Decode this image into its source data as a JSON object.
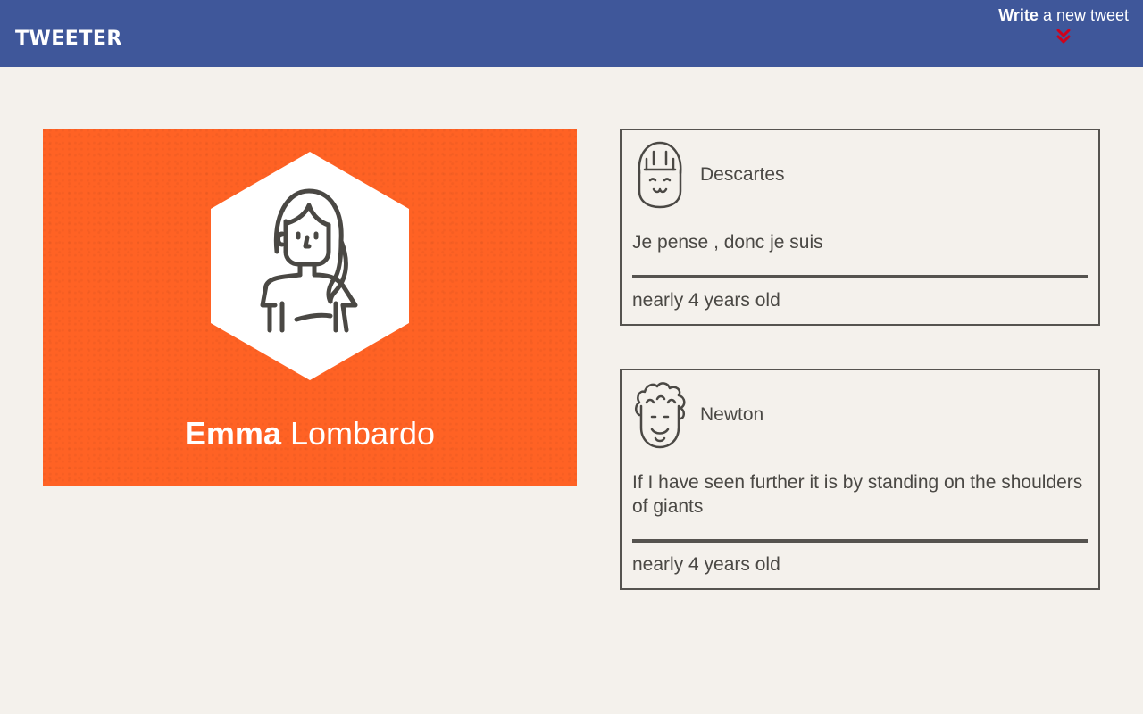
{
  "header": {
    "brand": "TWEETER",
    "compose_strong": "Write",
    "compose_rest": " a new tweet",
    "compose_icon": "double-chevron-down-icon",
    "bg_color": "#3f579a",
    "chevron_color": "#d0021b"
  },
  "profile": {
    "first_name": "Emma",
    "last_name": " Lombardo",
    "avatar_icon": "woman-avatar-icon",
    "card_color": "#ff6224"
  },
  "tweets": [
    {
      "author": "Descartes",
      "avatar_icon": "descartes-avatar-icon",
      "body": "Je pense , donc je suis",
      "age": "nearly 4 years old"
    },
    {
      "author": "Newton",
      "avatar_icon": "newton-avatar-icon",
      "body": "If I have seen further it is by standing on the shoulders of giants",
      "age": "nearly 4 years old"
    }
  ]
}
